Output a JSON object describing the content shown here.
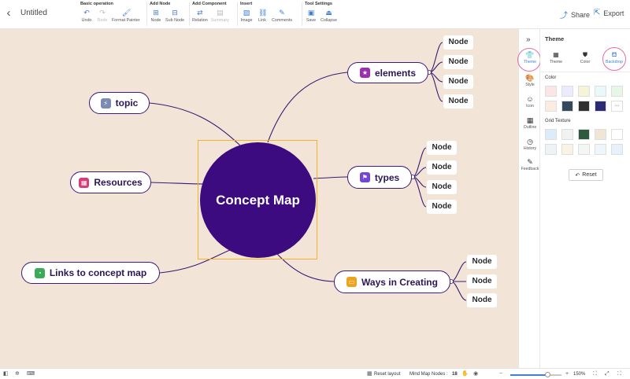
{
  "header": {
    "title": "Untitled",
    "groups": [
      {
        "label": "Basic operation",
        "tools": [
          {
            "label": "Undo",
            "icon": "undo-icon",
            "glyph": "↶",
            "disabled": false
          },
          {
            "label": "Redo",
            "icon": "redo-icon",
            "glyph": "↷",
            "disabled": true
          },
          {
            "label": "Format Painter",
            "icon": "format-painter-icon",
            "glyph": "🖌",
            "disabled": false
          }
        ]
      },
      {
        "label": "Add Node",
        "tools": [
          {
            "label": "Node",
            "icon": "node-icon",
            "glyph": "⊞",
            "disabled": false
          },
          {
            "label": "Sub Node",
            "icon": "sub-node-icon",
            "glyph": "⊟",
            "disabled": false
          }
        ]
      },
      {
        "label": "Add Component",
        "tools": [
          {
            "label": "Relation",
            "icon": "relation-icon",
            "glyph": "⇄",
            "disabled": false
          },
          {
            "label": "Summary",
            "icon": "summary-icon",
            "glyph": "▤",
            "disabled": true
          }
        ]
      },
      {
        "label": "Insert",
        "tools": [
          {
            "label": "Image",
            "icon": "image-icon",
            "glyph": "▨",
            "disabled": false
          },
          {
            "label": "Link",
            "icon": "link-icon",
            "glyph": "⛓",
            "disabled": false
          },
          {
            "label": "Comments",
            "icon": "comments-icon",
            "glyph": "✎",
            "disabled": false
          }
        ]
      },
      {
        "label": "Tool Settings",
        "tools": [
          {
            "label": "Save",
            "icon": "save-icon",
            "glyph": "▣",
            "disabled": false
          },
          {
            "label": "Collapse",
            "icon": "collapse-icon",
            "glyph": "⏏",
            "disabled": false
          }
        ]
      }
    ],
    "share_label": "Share",
    "export_label": "Export"
  },
  "map": {
    "center": "Concept Map",
    "branches": {
      "topic": {
        "label": "topic",
        "icon": "lightning-icon",
        "glyph": "⚡",
        "color": "#7b8bb3"
      },
      "resources": {
        "label": "Resources",
        "icon": "calendar-icon",
        "glyph": "▦",
        "color": "#d63c7c"
      },
      "links": {
        "label": "Links to concept map",
        "icon": "clock-icon",
        "glyph": "◔",
        "color": "#3caa5a"
      },
      "elements": {
        "label": "elements",
        "icon": "star-icon",
        "glyph": "★",
        "color": "#9b2fb0",
        "nodes": [
          "Node",
          "Node",
          "Node",
          "Node"
        ]
      },
      "types": {
        "label": "types",
        "icon": "flag-icon",
        "glyph": "⚑",
        "color": "#7346d9",
        "nodes": [
          "Node",
          "Node",
          "Node",
          "Node"
        ]
      },
      "ways": {
        "label": "Ways in Creating",
        "icon": "monitor-icon",
        "glyph": "▭",
        "color": "#f0a21a",
        "nodes": [
          "Node",
          "Node",
          "Node"
        ]
      }
    },
    "line_color": "#3a1a73",
    "canvas_color": "#f2e4d7",
    "center_color": "#3c0b7f"
  },
  "rail": {
    "items": [
      {
        "label": "Theme",
        "icon": "tshirt-icon",
        "glyph": "👕",
        "active": true
      },
      {
        "label": "Style",
        "icon": "palette-icon",
        "glyph": "🎨",
        "active": false
      },
      {
        "label": "Icon",
        "icon": "smiley-icon",
        "glyph": "☺",
        "active": false
      },
      {
        "label": "Outline",
        "icon": "outline-icon",
        "glyph": "▦",
        "active": false
      },
      {
        "label": "History",
        "icon": "history-icon",
        "glyph": "◷",
        "active": false
      },
      {
        "label": "Feedback",
        "icon": "feedback-icon",
        "glyph": "✎",
        "active": false
      }
    ]
  },
  "panel": {
    "title": "Theme",
    "tabs": [
      {
        "label": "Theme",
        "icon": "grid-icon",
        "glyph": "▦",
        "active": false
      },
      {
        "label": "Color",
        "icon": "color-icon",
        "glyph": "⛊",
        "active": false
      },
      {
        "label": "Backdrop",
        "icon": "paint-bucket-icon",
        "glyph": "⛾",
        "active": true
      }
    ],
    "color_label": "Color",
    "colors": [
      "#fbe5e7",
      "#ecebfd",
      "#f7f3d9",
      "#e9f8fb",
      "#e7f7e5",
      "#fcebe1",
      "#35495e",
      "#303030",
      "#2c2a73",
      ""
    ],
    "more_glyph": "···",
    "grid_label": "Grid Texture",
    "textures": [
      "#dcecf8",
      "#f2f2f2",
      "#2b5b3c",
      "#f1e5d6",
      "#ffffff",
      "#eef3f8",
      "#f9f3e3",
      "#f3f6f3",
      "#eef6fb",
      "#e6f1fb"
    ],
    "reset_label": "Reset"
  },
  "status": {
    "reset_layout": "Reset layout",
    "nodes_label": "Mind Map Nodes :",
    "nodes_count": "18",
    "zoom": "150%",
    "zoom_fraction": 0.72
  }
}
